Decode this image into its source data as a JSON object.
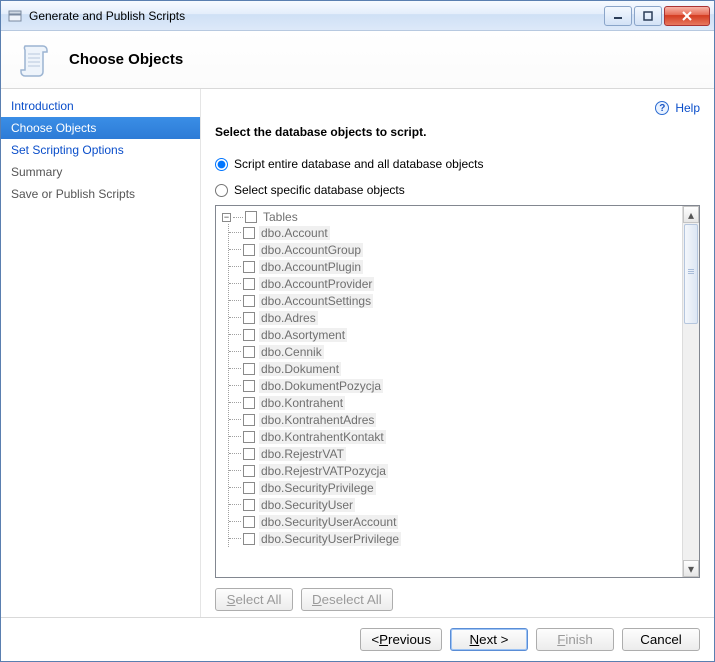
{
  "window": {
    "title": "Generate and Publish Scripts"
  },
  "header": {
    "title": "Choose Objects"
  },
  "sidebar": {
    "items": [
      {
        "label": "Introduction",
        "selected": false,
        "dimmed": false
      },
      {
        "label": "Choose Objects",
        "selected": true,
        "dimmed": false
      },
      {
        "label": "Set Scripting Options",
        "selected": false,
        "dimmed": false
      },
      {
        "label": "Summary",
        "selected": false,
        "dimmed": true
      },
      {
        "label": "Save or Publish Scripts",
        "selected": false,
        "dimmed": true
      }
    ]
  },
  "help": {
    "label": "Help"
  },
  "main": {
    "heading": "Select the database objects to script.",
    "radio_all": "Script entire database and all database objects",
    "radio_specific": "Select specific database objects",
    "selected_option": "all"
  },
  "tree": {
    "root": "Tables",
    "items": [
      "dbo.Account",
      "dbo.AccountGroup",
      "dbo.AccountPlugin",
      "dbo.AccountProvider",
      "dbo.AccountSettings",
      "dbo.Adres",
      "dbo.Asortyment",
      "dbo.Cennik",
      "dbo.Dokument",
      "dbo.DokumentPozycja",
      "dbo.Kontrahent",
      "dbo.KontrahentAdres",
      "dbo.KontrahentKontakt",
      "dbo.RejestrVAT",
      "dbo.RejestrVATPozycja",
      "dbo.SecurityPrivilege",
      "dbo.SecurityUser",
      "dbo.SecurityUserAccount",
      "dbo.SecurityUserPrivilege"
    ]
  },
  "buttons": {
    "select_all": "Select All",
    "deselect_all": "Deselect All",
    "previous": "Previous",
    "next": "Next",
    "finish": "Finish",
    "cancel": "Cancel"
  }
}
